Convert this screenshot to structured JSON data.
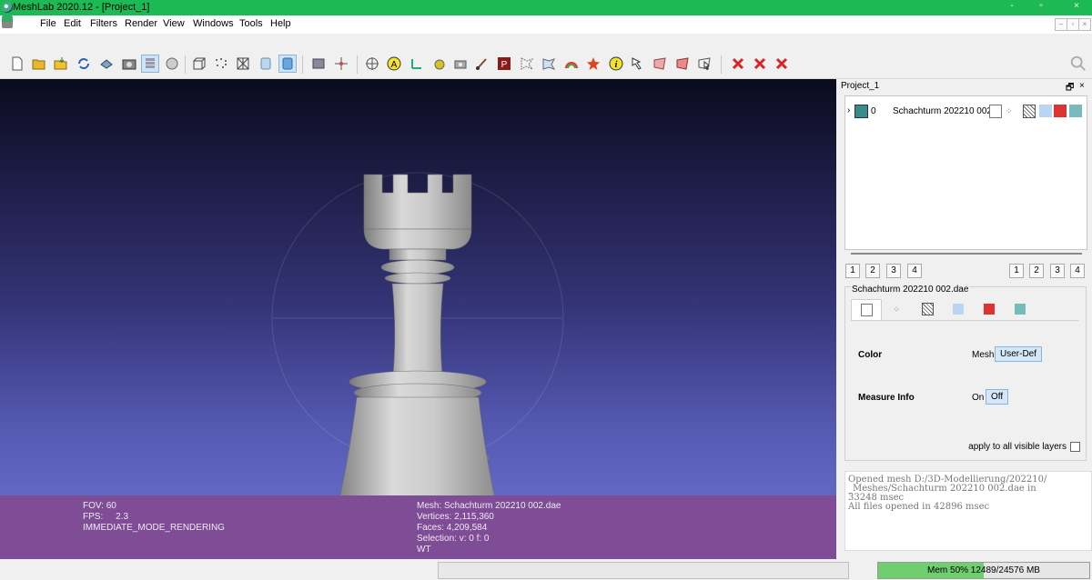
{
  "window": {
    "title": "MeshLab 2020.12 - [Project_1]",
    "min": "-",
    "max": "▫",
    "close": "×"
  },
  "menu": [
    "File",
    "Edit",
    "Filters",
    "Render",
    "View",
    "Windows",
    "Tools",
    "Help"
  ],
  "toolbar_icons": [
    "new-project",
    "open-project",
    "import-mesh",
    "reload",
    "export",
    "snapshot",
    "layers",
    "ruler",
    "bbox",
    "points",
    "wireframe",
    "flat",
    "smooth",
    "fill",
    "align",
    "trackball",
    "annotate",
    "axis",
    "paint-brush",
    "camera",
    "brush",
    "paint-p",
    "select-vertices",
    "select-faces",
    "rainbow",
    "georef",
    "info",
    "pick",
    "select-conn",
    "select-area",
    "delete-vertices",
    "delete-faces",
    "delete-sel"
  ],
  "viewport": {
    "info_left": [
      "FOV: 60",
      "FPS:     2.3",
      "IMMEDIATE_MODE_RENDERING"
    ],
    "info_right": [
      "Mesh: Schachturm 202210 002.dae",
      "Vertices: 2,115,360",
      "Faces: 4,209,584",
      "Selection: v: 0 f: 0",
      "WT"
    ]
  },
  "panel": {
    "title": "Project_1",
    "float_btn": "🗗",
    "close_btn": "×",
    "layer": {
      "expand": "›",
      "index": "0",
      "name": "Schachturm 202210 002"
    },
    "view_nums_left": [
      "1",
      "2",
      "3",
      "4"
    ],
    "view_nums_right": [
      "1",
      "2",
      "3",
      "4"
    ],
    "file_name": "Schachturm 202210 002.dae",
    "color_label": "Color",
    "color_mesh": "Mesh",
    "color_userdef": "User-Def",
    "measure_label": "Measure Info",
    "measure_on": "On",
    "measure_off": "Off",
    "apply_label": "apply to all visible layers"
  },
  "log": [
    "Opened mesh D:/3D-Modellierung/202210/",
    "_Meshes/Schachturm 202210 002.dae in",
    "33248 msec",
    "All files opened in 42896 msec"
  ],
  "status": {
    "memory": "Mem 50% 12489/24576 MB",
    "memory_pct": 50
  },
  "colors": {
    "titlebar": "#1db954",
    "infobar": "#7e4d95",
    "accent": "#cfe3f6"
  }
}
